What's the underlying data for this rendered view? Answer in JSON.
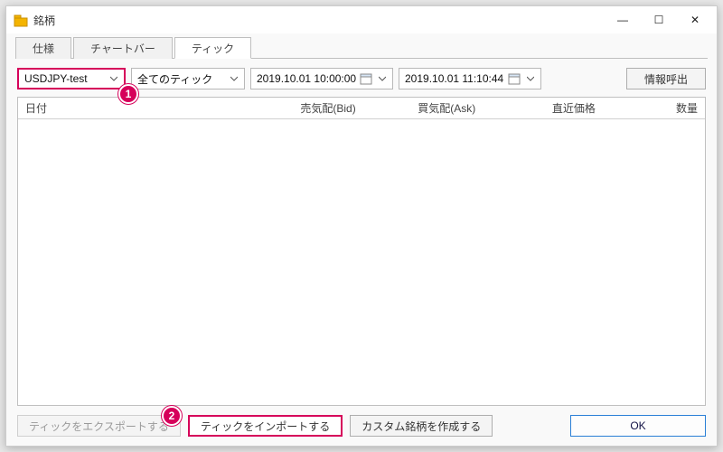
{
  "window": {
    "title": "銘柄",
    "buttons": {
      "min": "—",
      "max": "☐",
      "close": "✕"
    }
  },
  "tabs": {
    "spec": "仕様",
    "chartbar": "チャートバー",
    "tick": "ティック"
  },
  "filters": {
    "symbol": {
      "value": "USDJPY-test"
    },
    "ticktype": {
      "value": "全てのティック"
    },
    "from": {
      "value": "2019.10.01 10:00:00"
    },
    "to": {
      "value": "2019.10.01 11:10:44"
    },
    "request_label": "情報呼出"
  },
  "columns": {
    "date": "日付",
    "bid": "売気配(Bid)",
    "ask": "買気配(Ask)",
    "last": "直近価格",
    "vol": "数量"
  },
  "bottom": {
    "export": "ティックをエクスポートする",
    "import": "ティックをインポートする",
    "create_custom": "カスタム銘柄を作成する",
    "ok": "OK"
  },
  "callouts": {
    "one": "1",
    "two": "2"
  },
  "colors": {
    "accent": "#d6005a",
    "primary": "#2a7fd6"
  }
}
